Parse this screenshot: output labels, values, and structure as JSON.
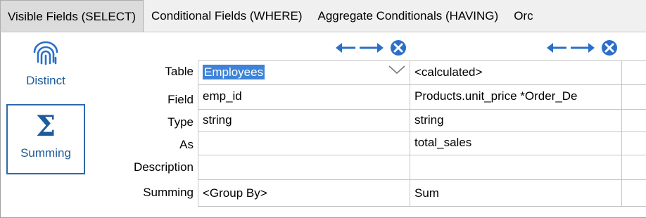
{
  "tabs": [
    {
      "label": "Visible Fields (SELECT)",
      "active": true
    },
    {
      "label": "Conditional Fields (WHERE)",
      "active": false
    },
    {
      "label": "Aggregate Conditionals (HAVING)",
      "active": false
    },
    {
      "label": "Orc",
      "active": false
    }
  ],
  "sidebar": {
    "distinct": {
      "label": "Distinct",
      "icon": "fingerprint-icon"
    },
    "summing": {
      "label": "Summing",
      "icon": "sigma-icon",
      "active": true
    }
  },
  "grid": {
    "row_labels": [
      "Table",
      "Field",
      "Type",
      "As",
      "Description",
      "Summing"
    ],
    "columns": [
      {
        "table": "Employees",
        "field": "emp_id",
        "type": "string",
        "as": "",
        "description": "",
        "summing": "<Group By>"
      },
      {
        "table": "<calculated>",
        "field": "Products.unit_price *Order_De",
        "type": "string",
        "as": "total_sales",
        "description": "",
        "summing": "Sum"
      }
    ]
  },
  "colors": {
    "accent": "#1c5a99",
    "selection": "#3d83d9",
    "icon_blue": "#2a6fc9"
  }
}
